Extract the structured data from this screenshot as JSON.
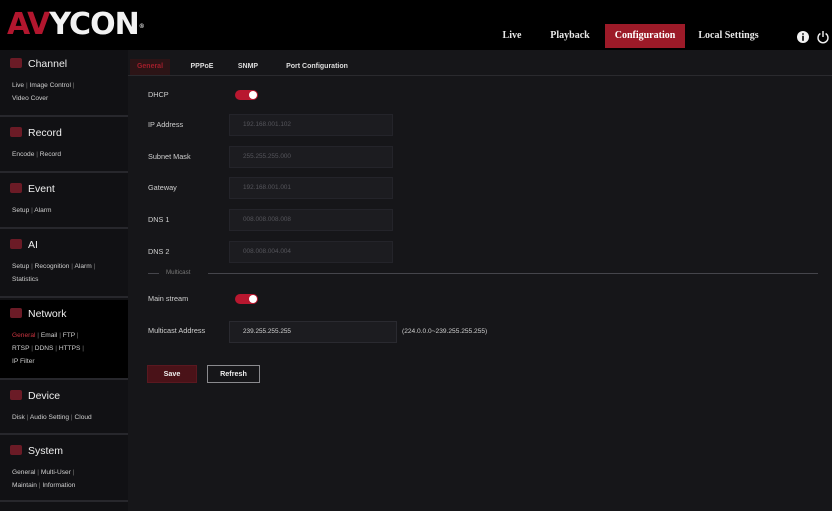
{
  "header": {
    "logo_a": "AV",
    "logo_b": "YCON",
    "logo_tm": "®",
    "nav": [
      {
        "label": "Live"
      },
      {
        "label": "Playback"
      },
      {
        "label": "Configuration"
      },
      {
        "label": "Local Settings"
      }
    ],
    "active_nav": "Configuration",
    "icons": [
      "info-icon",
      "power-icon"
    ]
  },
  "sidebar": {
    "sections": [
      {
        "title": "Channel",
        "icon": "channel-icon",
        "links": [
          "Live",
          "Image Control",
          "Video Cover"
        ]
      },
      {
        "title": "Record",
        "icon": "record-icon",
        "links": [
          "Encode",
          "Record"
        ]
      },
      {
        "title": "Event",
        "icon": "event-icon",
        "links": [
          "Setup",
          "Alarm"
        ]
      },
      {
        "title": "AI",
        "icon": "ai-icon",
        "links": [
          "Setup",
          "Recognition",
          "Alarm",
          "Statistics"
        ]
      },
      {
        "title": "Network",
        "icon": "network-icon",
        "links": [
          "General",
          "Email",
          "FTP",
          "RTSP",
          "DDNS",
          "HTTPS",
          "IP Filter"
        ],
        "active_link": "General"
      },
      {
        "title": "Device",
        "icon": "device-icon",
        "links": [
          "Disk",
          "Audio Setting",
          "Cloud"
        ]
      },
      {
        "title": "System",
        "icon": "system-icon",
        "links": [
          "General",
          "Multi-User",
          "Maintain",
          "Information"
        ]
      }
    ],
    "active_section": "Network"
  },
  "main": {
    "tabs": [
      {
        "label": "General"
      },
      {
        "label": "PPPoE"
      },
      {
        "label": "SNMP"
      },
      {
        "label": "Port Configuration"
      }
    ],
    "active_tab": "General",
    "form": {
      "dhcp_label": "DHCP",
      "dhcp_on": true,
      "ip_label": "IP Address",
      "ip_value": "192.168.001.102",
      "subnet_label": "Subnet Mask",
      "subnet_value": "255.255.255.000",
      "gateway_label": "Gateway",
      "gateway_value": "192.168.001.001",
      "dns1_label": "DNS 1",
      "dns1_value": "008.008.008.008",
      "dns2_label": "DNS 2",
      "dns2_value": "008.008.004.004",
      "multicast_group": "Multicast",
      "mainstream_label": "Main stream",
      "mainstream_on": true,
      "multicast_label": "Multicast Address",
      "multicast_value": "239.255.255.255",
      "multicast_hint": "(224.0.0.0~239.255.255.255)"
    },
    "buttons": {
      "save": "Save",
      "refresh": "Refresh"
    }
  },
  "colors": {
    "accent": "#9c1a28",
    "toggle_on": "#b8172f",
    "background": "#16161a"
  }
}
